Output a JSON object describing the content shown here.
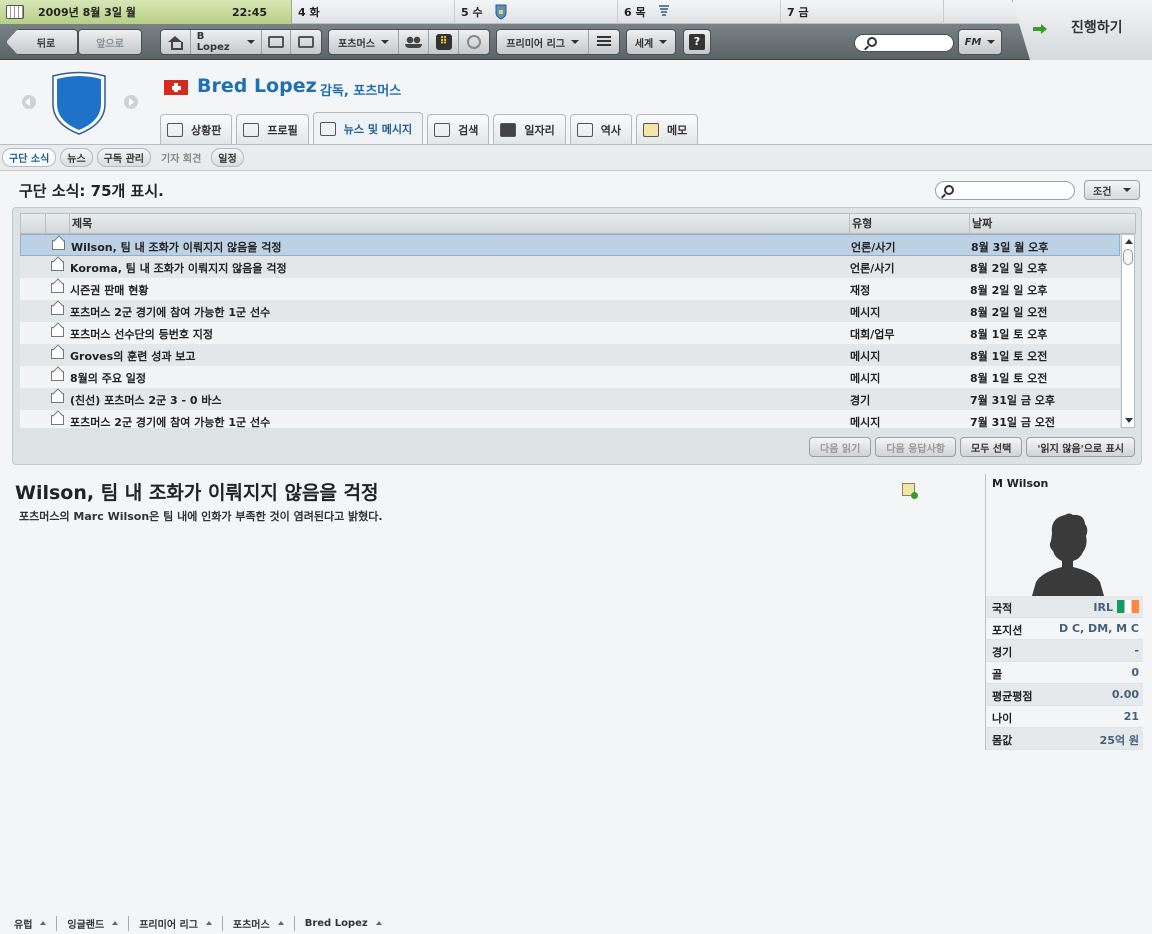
{
  "calendar": {
    "today_date": "2009년 8월 3일 월",
    "today_time": "22:45",
    "days": [
      "4 화",
      "5 수",
      "6 목",
      "7 금"
    ]
  },
  "toolbar": {
    "back_label": "뒤로",
    "forward_label": "앞으로",
    "manager_menu": "B Lopez",
    "club_menu": "포츠머스",
    "league_menu": "프리미어 리그",
    "world_menu": "세계",
    "help_label": "?",
    "fm_label": "FM",
    "continue_label": "진행하기"
  },
  "header": {
    "manager_name": "Bred Lopez",
    "manager_role": "감독, 포츠머스",
    "tabs": [
      {
        "label": "상황판"
      },
      {
        "label": "프로필"
      },
      {
        "label": "뉴스 및 메시지"
      },
      {
        "label": "검색"
      },
      {
        "label": "일자리"
      },
      {
        "label": "역사"
      },
      {
        "label": "메모"
      }
    ]
  },
  "subnav": {
    "items": [
      {
        "label": "구단 소식"
      },
      {
        "label": "뉴스"
      },
      {
        "label": "구독 관리"
      },
      {
        "label": "기자 회견"
      },
      {
        "label": "일정"
      }
    ]
  },
  "inbox": {
    "title": "구단 소식: 75개 표시.",
    "filter_label": "조건",
    "columns": {
      "title": "제목",
      "type": "유형",
      "date": "날짜"
    },
    "rows": [
      {
        "title": "Wilson, 팀 내 조화가 이뤄지지 않음을 걱정",
        "type": "언론/사기",
        "date": "8월 3일 월 오후"
      },
      {
        "title": "Koroma, 팀 내 조화가 이뤄지지 않음을 걱정",
        "type": "언론/사기",
        "date": "8월 2일 일 오후"
      },
      {
        "title": "시즌권 판매 현황",
        "type": "재정",
        "date": "8월 2일 일 오후"
      },
      {
        "title": "포츠머스 2군 경기에 참여 가능한 1군 선수",
        "type": "메시지",
        "date": "8월 2일 일 오전"
      },
      {
        "title": "포츠머스 선수단의 등번호 지정",
        "type": "대회/업무",
        "date": "8월 1일 토 오후"
      },
      {
        "title": "Groves의 훈련 성과 보고",
        "type": "메시지",
        "date": "8월 1일 토 오전"
      },
      {
        "title": "8월의 주요 일정",
        "type": "메시지",
        "date": "8월 1일 토 오전"
      },
      {
        "title": "(친선) 포츠머스 2군 3 - 0 바스",
        "type": "경기",
        "date": "7월 31일 금 오후"
      },
      {
        "title": "포츠머스 2군 경기에 참여 가능한 1군 선수",
        "type": "메시지",
        "date": "7월 31일 금 오전"
      }
    ],
    "actions": {
      "next_unread": "다음 읽기",
      "next_reply": "다음 응답사항",
      "select_all": "모두 선택",
      "mark_unread": "'읽지 않음'으로 표시"
    }
  },
  "message": {
    "headline": "Wilson, 팀 내 조화가 이뤄지지 않음을 걱정",
    "body": "포츠머스의 Marc Wilson은 팀 내에 인화가 부족한 것이 염려된다고 밝혔다."
  },
  "player": {
    "name": "M Wilson",
    "stats": [
      {
        "label": "국적",
        "value": "IRL"
      },
      {
        "label": "포지션",
        "value": "D C, DM, M C"
      },
      {
        "label": "경기",
        "value": "-"
      },
      {
        "label": "골",
        "value": "0"
      },
      {
        "label": "평균평점",
        "value": "0.00"
      },
      {
        "label": "나이",
        "value": "21"
      },
      {
        "label": "몸값",
        "value": "25억 원"
      }
    ]
  },
  "footer": {
    "crumbs": [
      "유럽",
      "잉글랜드",
      "프리미어 리그",
      "포츠머스",
      "Bred Lopez"
    ]
  },
  "colors": {
    "accent": "#1f6fb4",
    "selected_row": "#bcd1e3",
    "calendar_today": "#b8cf86"
  }
}
